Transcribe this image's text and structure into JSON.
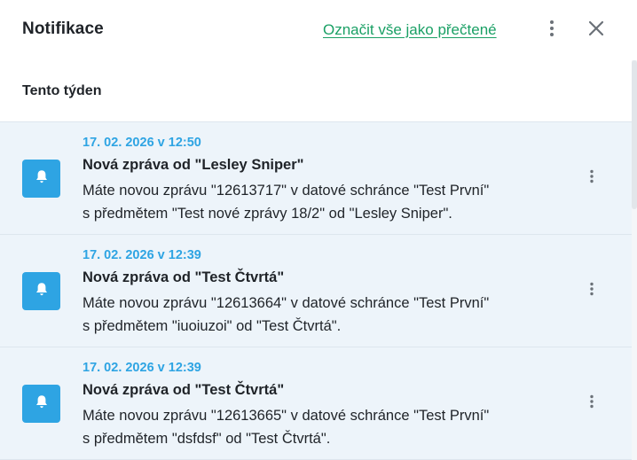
{
  "header": {
    "title": "Notifikace",
    "mark_all_label": "Označit vše jako přečtené",
    "more_icon": "more-vertical-icon",
    "close_icon": "close-icon"
  },
  "section": {
    "title": "Tento týden"
  },
  "colors": {
    "accent": "#2ea4e3",
    "link_green": "#1aa065",
    "item_background": "#edf4fa"
  },
  "notifications": [
    {
      "icon": "bell-icon",
      "date": "17. 02. 2026 v 12:50",
      "title": "Nová zpráva od \"Lesley Sniper\"",
      "body_line1": "Máte novou zprávu \"12613717\" v datové schránce \"Test První\"",
      "body_line2": "s předmětem \"Test nové zprávy 18/2\" od \"Lesley Sniper\"."
    },
    {
      "icon": "bell-icon",
      "date": "17. 02. 2026 v 12:39",
      "title": "Nová zpráva od \"Test Čtvrtá\"",
      "body_line1": "Máte novou zprávu \"12613664\" v datové schránce \"Test První\"",
      "body_line2": "s předmětem \"iuoiuzoi\" od \"Test Čtvrtá\"."
    },
    {
      "icon": "bell-icon",
      "date": "17. 02. 2026 v 12:39",
      "title": "Nová zpráva od \"Test Čtvrtá\"",
      "body_line1": "Máte novou zprávu \"12613665\" v datové schránce \"Test První\"",
      "body_line2": "s předmětem \"dsfdsf\" od \"Test Čtvrtá\"."
    }
  ]
}
